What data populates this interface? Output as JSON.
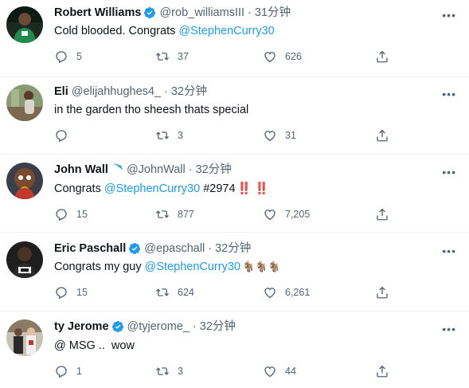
{
  "tweets": [
    {
      "name": "Robert Williams",
      "verified": true,
      "handle": "@rob_williamsIII",
      "dot": "·",
      "time": "31分钟",
      "text_parts": [
        "Cold blooded. Congrats ",
        "@StephenCurry30",
        "",
        ""
      ],
      "replies": "5",
      "retweets": "37",
      "likes": "626",
      "avatar": "green-jersey-player"
    },
    {
      "name": "Eli",
      "verified": false,
      "handle": "@elijahhughes4_",
      "dot": "·",
      "time": "32分钟",
      "text_parts": [
        "in the garden tho sheesh thats special",
        "",
        "",
        ""
      ],
      "replies": "",
      "retweets": "3",
      "likes": "31",
      "avatar": "outdoor-photo"
    },
    {
      "name": "John Wall",
      "verified": true,
      "handle": "@JohnWall",
      "dot": "·",
      "time": "32分钟",
      "text_parts": [
        "Congrats ",
        "@StephenCurry30",
        " #2974",
        "‼️ ‼️"
      ],
      "replies": "15",
      "retweets": "877",
      "likes": "7,205",
      "avatar": "cartoon-character"
    },
    {
      "name": "Eric Paschall",
      "verified": true,
      "handle": "@epaschall",
      "dot": "·",
      "time": "32分钟",
      "text_parts": [
        "Congrats my guy ",
        "@StephenCurry30",
        "",
        "🐐🐐🐐"
      ],
      "replies": "15",
      "retweets": "624",
      "likes": "6,261",
      "avatar": "jazz-jersey-player"
    },
    {
      "name": "ty Jerome",
      "verified": true,
      "handle": "@tyjerome_",
      "dot": "·",
      "time": "32分钟",
      "text_parts": [
        "@ MSG ..  wow",
        "",
        "",
        ""
      ],
      "replies": "1",
      "retweets": "3",
      "likes": "44",
      "avatar": "two-people-photo"
    }
  ],
  "more_glyph": "•••",
  "colors": {
    "link": "#1d9bf0",
    "muted": "#536471",
    "verified": "#1d9bf0",
    "divider": "#eff3f4"
  },
  "icons": [
    "reply-icon",
    "retweet-icon",
    "like-icon",
    "share-icon",
    "verified-badge-icon",
    "more-icon"
  ]
}
